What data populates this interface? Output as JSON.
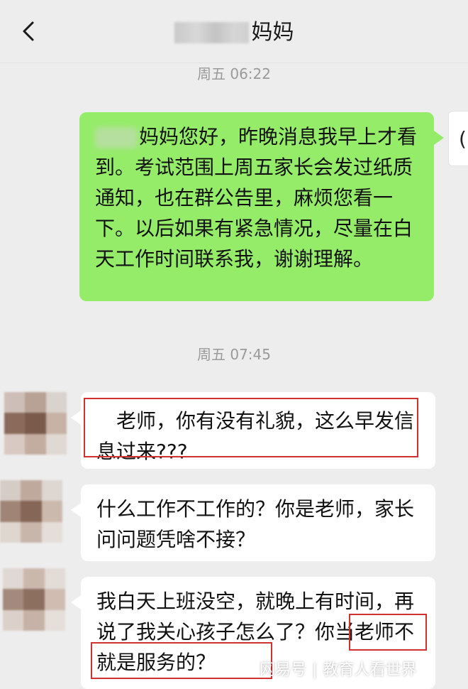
{
  "header": {
    "title": "妈妈",
    "back_icon": "chevron-left-icon"
  },
  "messages": {
    "time_1": "周五 06:22",
    "me_1": "妈妈您好，昨晚消息我早上才看到。考试范围上周五家长会发过纸质通知，也在群公告里，麻烦您看一下。以后如果有紧急情况，尽量在白天工作时间联系我，谢谢理解。",
    "time_2": "周五 07:45",
    "other_1": "老师，你有没有礼貌，这么早发信息过来???",
    "other_2": "什么工作不工作的？你是老师，家长问问题凭啥不接？",
    "other_3a": "我白天上班没空，就晚上有时间，再说了我关心孩子怎么了？",
    "other_3b": "你当老师不就是服务的？"
  },
  "watermark": {
    "source": "网易号",
    "author": "教育人看世界"
  },
  "colors": {
    "background": "#ededed",
    "my_bubble": "#95ec69",
    "other_bubble": "#ffffff",
    "highlight_box": "#d0322f",
    "timestamp": "#9a9a9a"
  },
  "avatar_me_glyph": "("
}
